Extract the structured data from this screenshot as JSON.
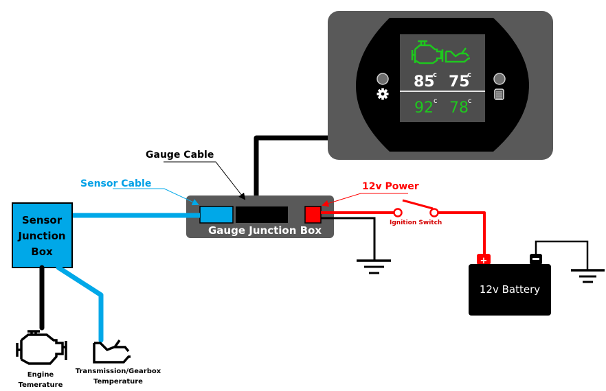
{
  "labels": {
    "gauge_cable": "Gauge Cable",
    "sensor_cable": "Sensor Cable",
    "power": "12v Power",
    "ignition_switch": "Ignition Switch",
    "gauge_junction_box": "Gauge Junction Box",
    "sensor_junction_box": [
      "Sensor",
      "Junction",
      "Box"
    ],
    "battery": "12v Battery",
    "battery_positive": "+",
    "battery_negative": "−",
    "engine": [
      "Engine",
      "Temerature"
    ],
    "transmission": [
      "Transmission/Gearbox",
      "Temperature"
    ]
  },
  "gauge_display": {
    "unit": "c",
    "current": {
      "engine": "85",
      "transmission": "75"
    },
    "max": {
      "engine": "92",
      "transmission": "78"
    },
    "left_button_icon": "gear-icon",
    "right_button_icon": "list-icon"
  },
  "colors": {
    "sensor_blue": "#00a8e8",
    "power_red": "#ff0000",
    "gauge_green": "#1ec81e",
    "housing_gray": "#595959",
    "screen_gray": "#4d4d4d",
    "label_blue": "#00a0e6"
  }
}
